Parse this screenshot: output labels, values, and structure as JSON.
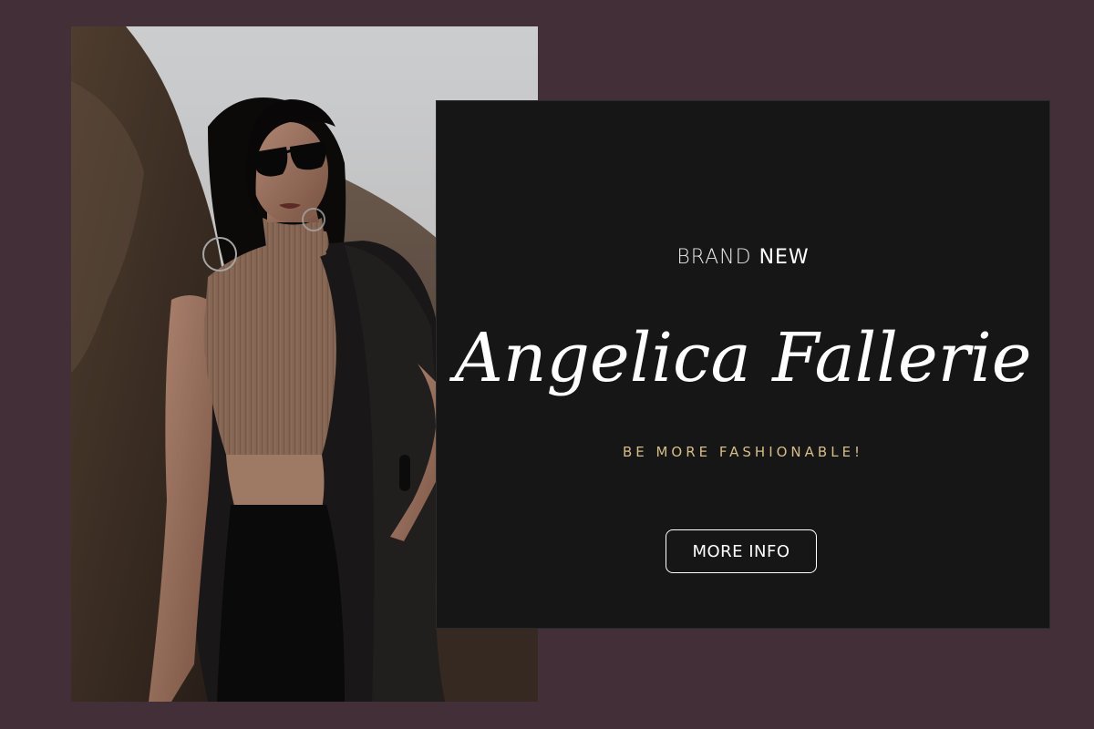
{
  "colors": {
    "background": "#432f37",
    "card": "#161616",
    "accent_gold": "#d6be86",
    "text": "#ffffff"
  },
  "kicker": {
    "word1": "BRAND",
    "word2": "NEW"
  },
  "title_script": "Angelica Fallerie",
  "tagline": "BE MORE FASHIONABLE!",
  "cta_label": "MORE INFO",
  "photo": {
    "subject": "fashion-portrait-woman-sunglasses"
  }
}
